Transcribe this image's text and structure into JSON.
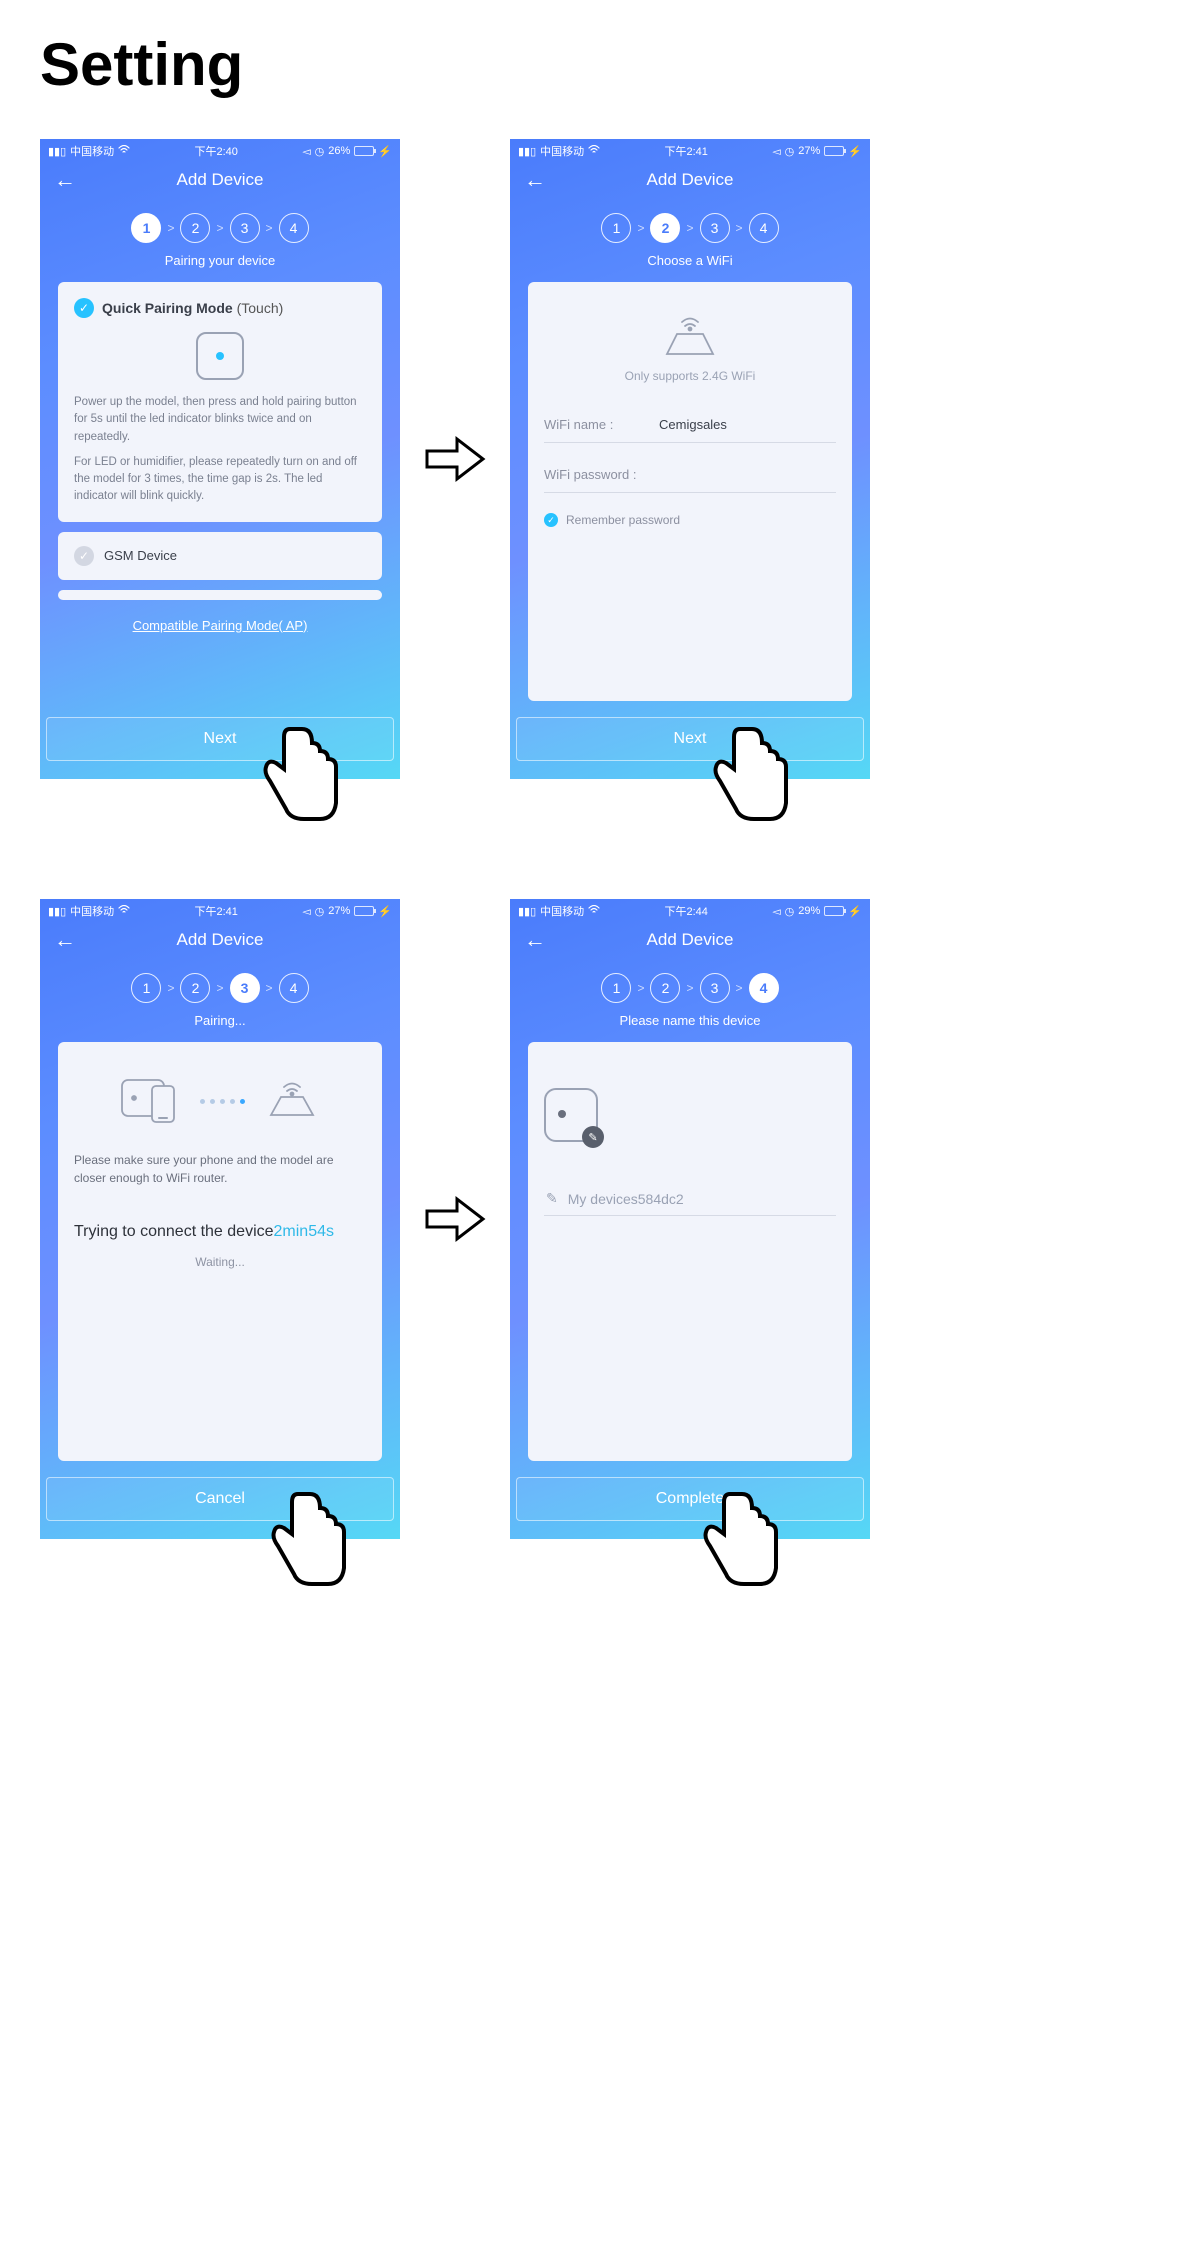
{
  "page_title": "Setting",
  "common": {
    "carrier": "中国移动",
    "nav_title": "Add Device",
    "step_sep": ">"
  },
  "s1": {
    "time": "下午2:40",
    "batt": "26%",
    "steps": [
      "1",
      "2",
      "3",
      "4"
    ],
    "active_step": 1,
    "subtitle": "Pairing your device",
    "qp_title": "Quick Pairing Mode",
    "qp_sub": " (Touch)",
    "instr1": "Power up the model, then press and hold pairing button for 5s until the led indicator blinks twice and on repeatedly.",
    "instr2": "For LED or humidifier, please repeatedly turn on and off the model for 3 times, the time gap is 2s. The led indicator will blink quickly.",
    "gsm_label": "GSM Device",
    "compat": "Compatible Pairing Mode( AP)",
    "btn": "Next"
  },
  "s2": {
    "time": "下午2:41",
    "batt": "27%",
    "active_step": 2,
    "subtitle": "Choose a WiFi",
    "support": "Only supports 2.4G WiFi",
    "name_label": "WiFi name :",
    "name_value": "Cemigsales",
    "pwd_label": "WiFi password :",
    "remember": "Remember password",
    "btn": "Next"
  },
  "s3": {
    "time": "下午2:41",
    "batt": "27%",
    "active_step": 3,
    "subtitle": "Pairing...",
    "note": "Please make sure your phone and the model are closer enough to WiFi router.",
    "trying": "Trying to connect the device",
    "timer": "2min54s",
    "waiting": "Waiting...",
    "btn": "Cancel"
  },
  "s4": {
    "time": "下午2:44",
    "batt": "29%",
    "active_step": 4,
    "subtitle": "Please name this device",
    "name_value": "My devices584dc2",
    "btn": "Complete"
  }
}
